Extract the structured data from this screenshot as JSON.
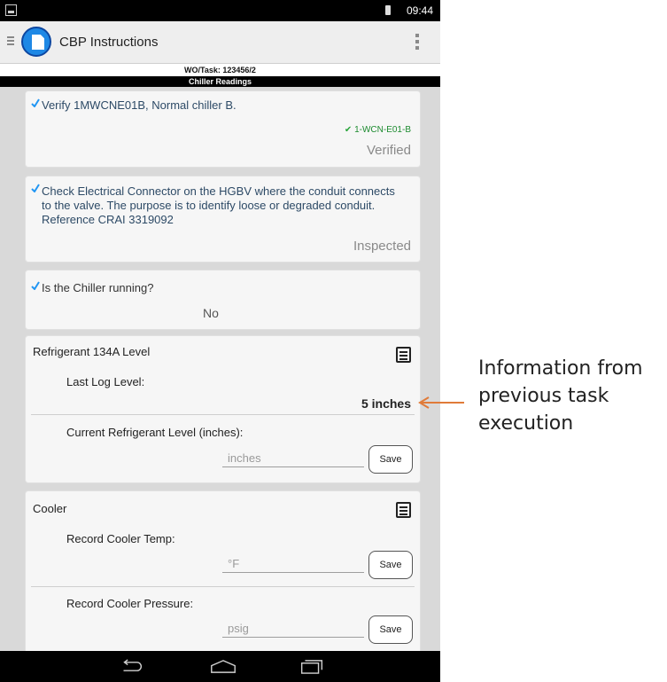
{
  "status_bar": {
    "time": "09:44",
    "icons": [
      "screenshot-icon",
      "battery-icon"
    ]
  },
  "app": {
    "title": "CBP Instructions",
    "icons": [
      "menu-icon",
      "app-logo-icon",
      "overflow-menu-icon"
    ]
  },
  "work_order": {
    "label": "WO/Task: 123456/2",
    "section": "Chiller Readings"
  },
  "steps": [
    {
      "text": "Verify 1MWCNE01B, Normal chiller B.",
      "tag": "1-WCN-E01-B",
      "status": "Verified"
    },
    {
      "text": "Check Electrical Connector on the HGBV where the conduit connects to the valve. The purpose is to identify loose or degraded conduit. Reference CRAI 3319092",
      "status": "Inspected"
    },
    {
      "text": "Is the Chiller running?",
      "answer": "No"
    }
  ],
  "refrigerant": {
    "title": "Refrigerant 134A Level",
    "last_log_label": "Last Log Level:",
    "last_log_value": "5 inches",
    "current_label": "Current Refrigerant Level (inches):",
    "current_placeholder": "inches",
    "save_label": "Save"
  },
  "cooler": {
    "title": "Cooler",
    "temp_label": "Record Cooler Temp:",
    "temp_placeholder": "°F",
    "pressure_label": "Record Cooler Pressure:",
    "pressure_placeholder": "psig",
    "save_label": "Save"
  },
  "nav": {
    "icons": [
      "back-icon",
      "home-icon",
      "recent-apps-icon"
    ]
  },
  "annotation": {
    "lines": [
      "Information from",
      "previous task",
      "execution"
    ]
  },
  "colors": {
    "accent_blue": "#1e88e5",
    "check_blue": "#2196f3",
    "verified_green": "#1b8a2e",
    "arrow_orange": "#e07b39"
  }
}
